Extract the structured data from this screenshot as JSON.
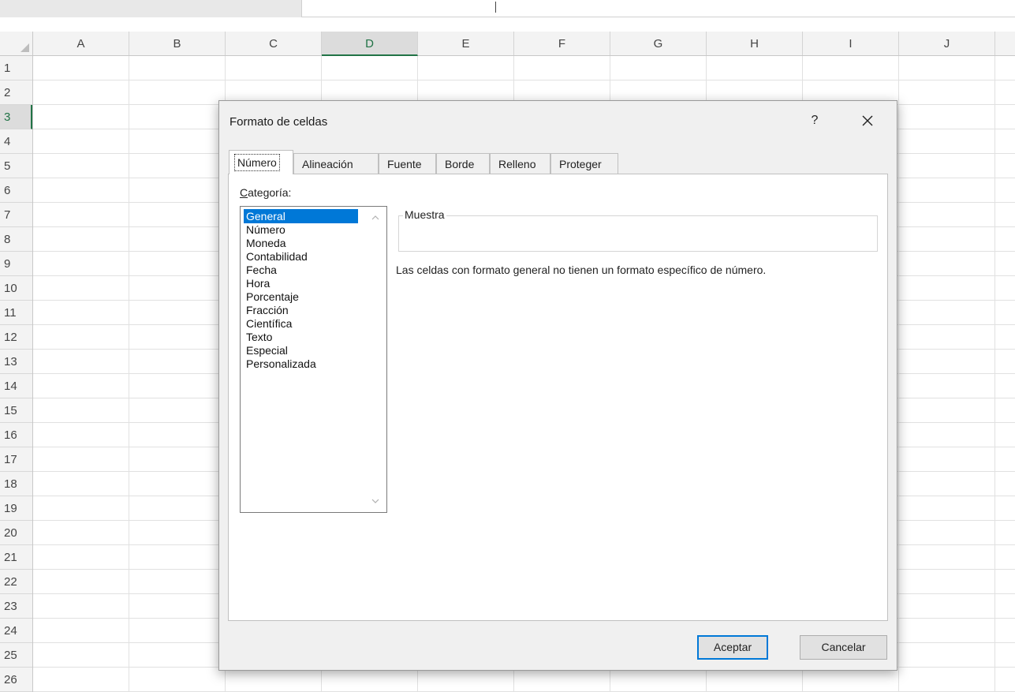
{
  "sheet": {
    "columns": [
      "A",
      "B",
      "C",
      "D",
      "E",
      "F",
      "G",
      "H",
      "I",
      "J"
    ],
    "selected_column": "D",
    "rows": [
      "1",
      "2",
      "3",
      "4",
      "5",
      "6",
      "7",
      "8",
      "9",
      "10",
      "11",
      "12",
      "13",
      "14",
      "15",
      "16",
      "17",
      "18",
      "19",
      "20",
      "21",
      "22",
      "23",
      "24",
      "25",
      "26"
    ],
    "selected_row": "3"
  },
  "dialog": {
    "title": "Formato de celdas",
    "help": "?",
    "close_icon": "close-icon",
    "tabs": [
      {
        "label": "Número",
        "active": true
      },
      {
        "label": "Alineación",
        "active": false
      },
      {
        "label": "Fuente",
        "active": false
      },
      {
        "label": "Borde",
        "active": false
      },
      {
        "label": "Relleno",
        "active": false
      },
      {
        "label": "Proteger",
        "active": false
      }
    ],
    "category_label_prefix": "C",
    "category_label_rest": "ategoría:",
    "categories": [
      "General",
      "Número",
      "Moneda",
      "Contabilidad",
      "Fecha",
      "Hora",
      "Porcentaje",
      "Fracción",
      "Científica",
      "Texto",
      "Especial",
      "Personalizada"
    ],
    "selected_category": "General",
    "sample_label": "Muestra",
    "description": "Las celdas con formato general no tienen un formato específico de número.",
    "ok_label": "Aceptar",
    "cancel_label": "Cancelar"
  },
  "colors": {
    "selection_blue": "#0078d7",
    "excel_green": "#217346"
  }
}
